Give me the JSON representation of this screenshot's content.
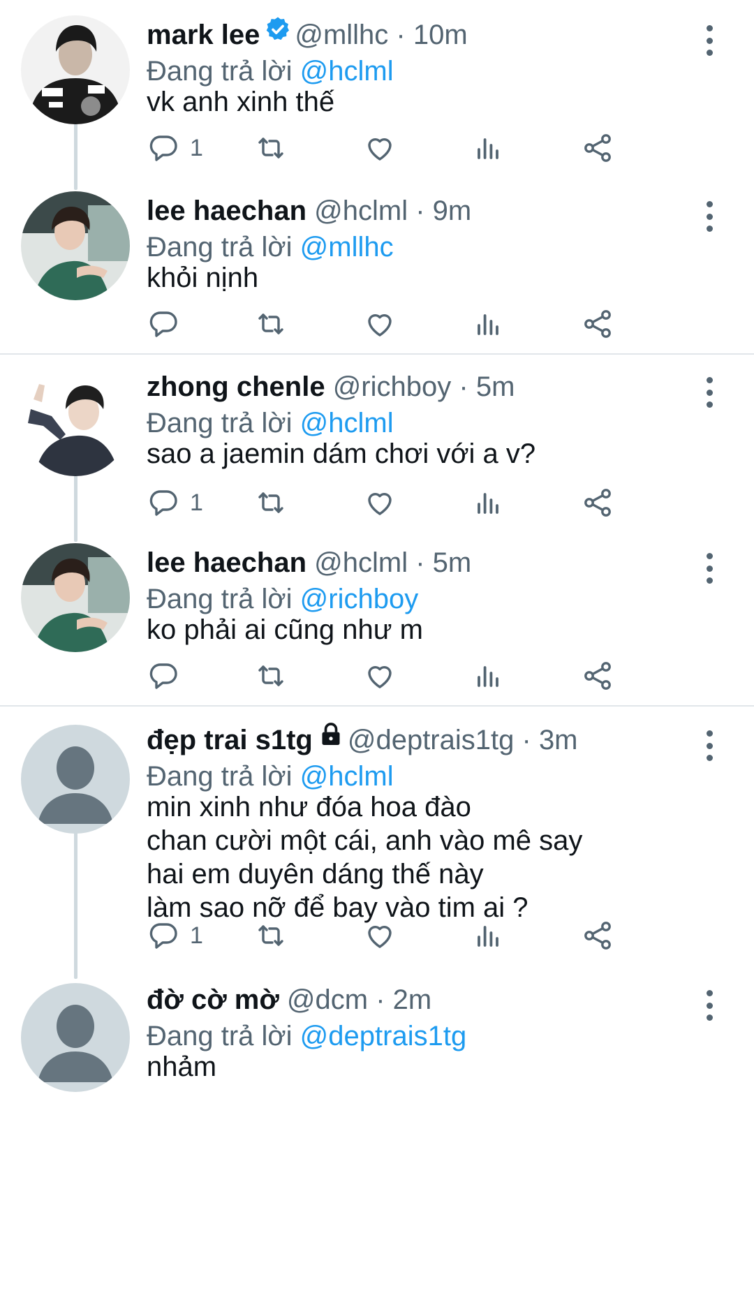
{
  "reply_prefix": "Đang trả lời",
  "tweets": [
    {
      "name": "mark lee",
      "verified": true,
      "handle": "@mllhc",
      "dot": "·",
      "time": "10m",
      "reply_to": "@hclml",
      "text": "vk anh xinh thế",
      "reply_count": "1"
    },
    {
      "name": "lee haechan",
      "handle": "@hclml",
      "dot": "·",
      "time": "9m",
      "reply_to": "@mllhc",
      "text": "khỏi nịnh",
      "reply_count": ""
    },
    {
      "name": "zhong chenle",
      "handle": "@richboy",
      "dot": "·",
      "time": "5m",
      "reply_to": "@hclml",
      "text": "sao a jaemin dám chơi với a v?",
      "reply_count": "1"
    },
    {
      "name": "lee haechan",
      "handle": "@hclml",
      "dot": "·",
      "time": "5m",
      "reply_to": "@richboy",
      "text": "ko phải ai cũng như m",
      "reply_count": ""
    },
    {
      "name": "đẹp trai s1tg",
      "locked": true,
      "handle": "@deptrais1tg",
      "dot": "·",
      "time": "3m",
      "reply_to": "@hclml",
      "text": "min xinh như đóa hoa đào\nchan cười một cái, anh vào mê say\nhai em duyên dáng thế này\nlàm sao nỡ để bay vào tim ai ?",
      "reply_count": "1"
    },
    {
      "name": "đờ cờ mờ",
      "handle": "@dcm",
      "dot": "·",
      "time": "2m",
      "reply_to": "@deptrais1tg",
      "text": "nhảm",
      "reply_count": ""
    }
  ],
  "icons": {
    "reply": "speech-bubble-icon",
    "retweet": "retweet-icon",
    "like": "heart-icon",
    "views": "bar-chart-icon",
    "share": "share-icon",
    "more": "vertical-dots-icon",
    "verified": "verified-badge-icon",
    "lock": "lock-icon"
  },
  "colors": {
    "mention": "#1d9bf0",
    "secondary_text": "#536471",
    "thread_line": "#cfd9de",
    "verified": "#1d9bf0"
  }
}
